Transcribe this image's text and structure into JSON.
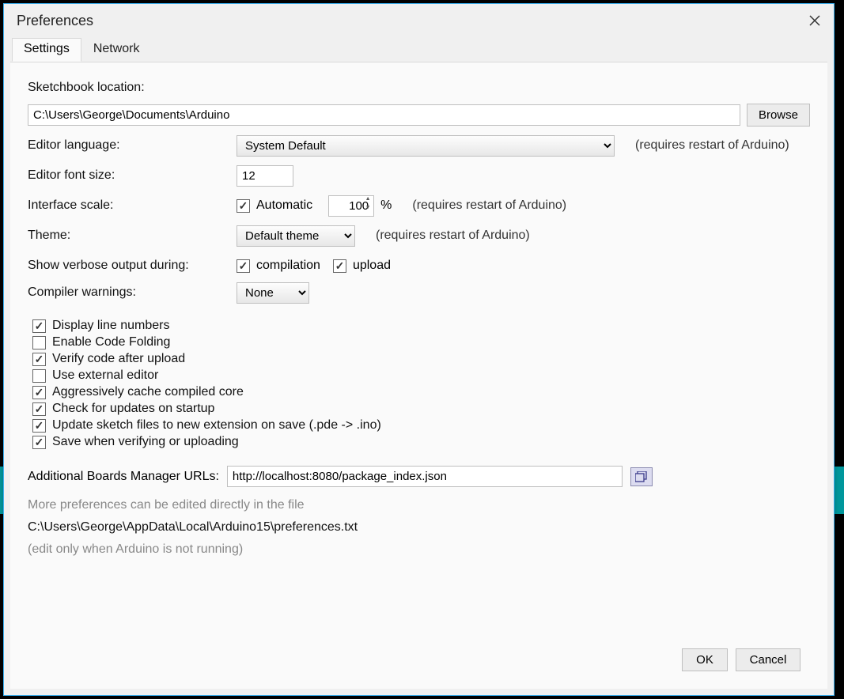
{
  "title": "Preferences",
  "tabs": {
    "settings": "Settings",
    "network": "Network"
  },
  "sketchbook": {
    "label": "Sketchbook location:",
    "path": "C:\\Users\\George\\Documents\\Arduino",
    "browse": "Browse"
  },
  "language": {
    "label": "Editor language:",
    "value": "System Default",
    "hint": "(requires restart of Arduino)"
  },
  "fontsize": {
    "label": "Editor font size:",
    "value": "12"
  },
  "scale": {
    "label": "Interface scale:",
    "auto_label": "Automatic",
    "auto_checked": true,
    "value": "100",
    "pct": "%",
    "hint": "(requires restart of Arduino)"
  },
  "theme": {
    "label": "Theme:",
    "value": "Default theme",
    "hint": "(requires restart of Arduino)"
  },
  "verbose": {
    "label": "Show verbose output during:",
    "compilation_label": "compilation",
    "compilation_checked": true,
    "upload_label": "upload",
    "upload_checked": true
  },
  "warnings": {
    "label": "Compiler warnings:",
    "value": "None"
  },
  "checks": {
    "line_numbers": {
      "label": "Display line numbers",
      "checked": true
    },
    "code_folding": {
      "label": "Enable Code Folding",
      "checked": false
    },
    "verify_upload": {
      "label": "Verify code after upload",
      "checked": true
    },
    "external_editor": {
      "label": "Use external editor",
      "checked": false
    },
    "cache_core": {
      "label": "Aggressively cache compiled core",
      "checked": true
    },
    "check_updates": {
      "label": "Check for updates on startup",
      "checked": true
    },
    "update_ext": {
      "label": "Update sketch files to new extension on save (.pde -> .ino)",
      "checked": true
    },
    "save_verify": {
      "label": "Save when verifying or uploading",
      "checked": true
    }
  },
  "boards": {
    "label": "Additional Boards Manager URLs:",
    "value": "http://localhost:8080/package_index.json"
  },
  "more": {
    "line1": "More preferences can be edited directly in the file",
    "path": "C:\\Users\\George\\AppData\\Local\\Arduino15\\preferences.txt",
    "line2": "(edit only when Arduino is not running)"
  },
  "buttons": {
    "ok": "OK",
    "cancel": "Cancel"
  }
}
